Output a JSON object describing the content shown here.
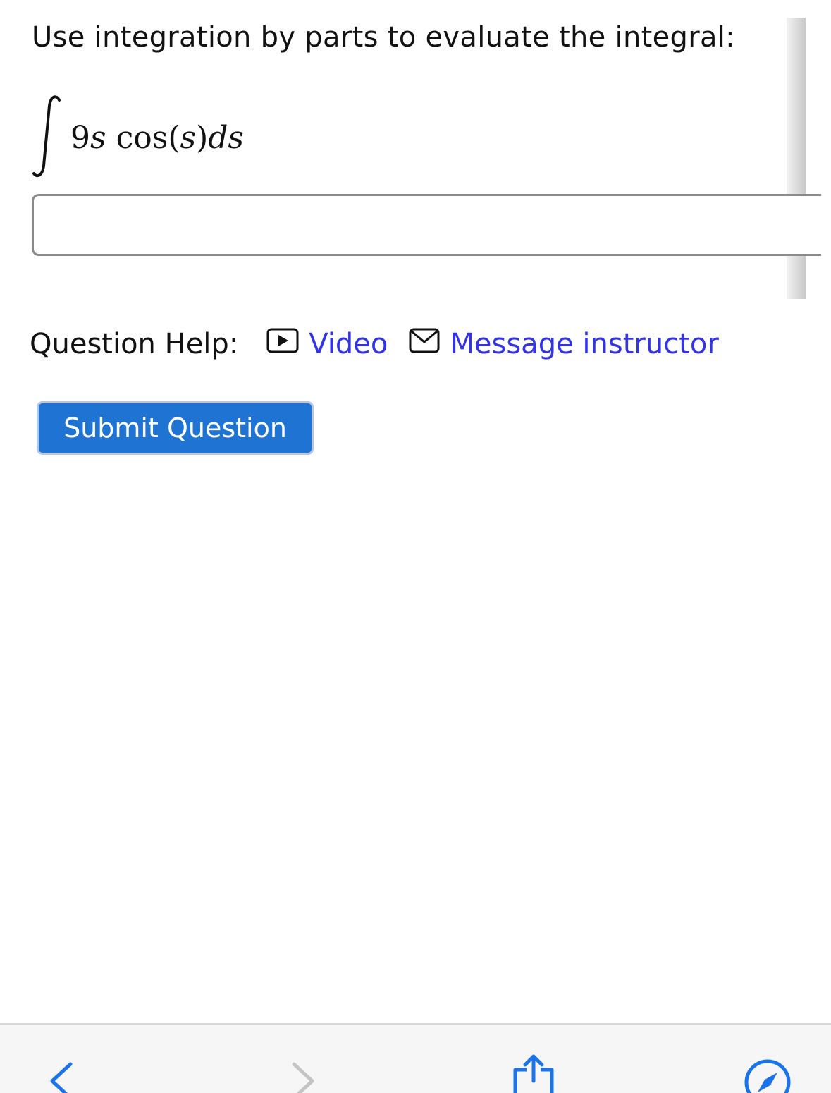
{
  "question": {
    "prompt": "Use integration by parts to evaluate the integral:",
    "integrand": {
      "coefficient": "9",
      "variable": "s",
      "function": "cos",
      "open_paren": "(",
      "argument": "s",
      "close_paren": ")",
      "differential_d": "d",
      "differential_var": "s"
    },
    "answer_value": ""
  },
  "help": {
    "label": "Question Help:",
    "video_label": "Video",
    "message_label": "Message instructor"
  },
  "submit": {
    "label": "Submit Question"
  },
  "browser_toolbar": {
    "icons": [
      "back-icon",
      "forward-icon",
      "share-icon",
      "compass-icon"
    ]
  },
  "colors": {
    "link": "#3333e6",
    "submit_button": "#1f73d3",
    "submit_text": "#ffffff"
  }
}
